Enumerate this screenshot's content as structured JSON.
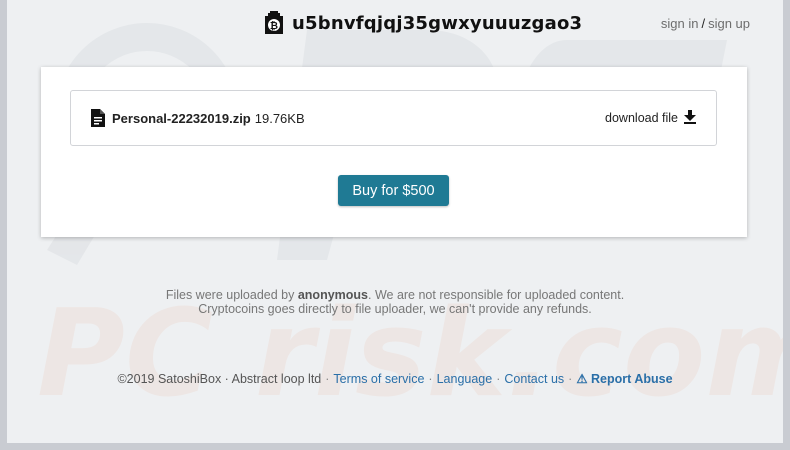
{
  "header": {
    "site_id": "u5bnvfqjqj35gwxyuuuzgao3",
    "sign_in": "sign in",
    "separator": "/",
    "sign_up": "sign up"
  },
  "file": {
    "name": "Personal-22232019.zip",
    "size": "19.76KB",
    "download_label": "download file"
  },
  "buy_button": "Buy for $500",
  "notice": {
    "line1_prefix": "Files were uploaded by",
    "uploader": "anonymous",
    "line1_suffix": ". We are not responsible for uploaded content.",
    "line2": "Cryptocoins goes directly to file uploader, we can't provide any refunds."
  },
  "footer": {
    "copyright": "©2019 SatoshiBox · Abstract loop ltd",
    "links": [
      "Terms of service",
      "Language",
      "Contact us"
    ],
    "report_icon": "⚠",
    "report": "Report Abuse"
  },
  "watermark": "PC risk.com",
  "colors": {
    "accent": "#1f7a94",
    "link": "#2a6fa8"
  }
}
